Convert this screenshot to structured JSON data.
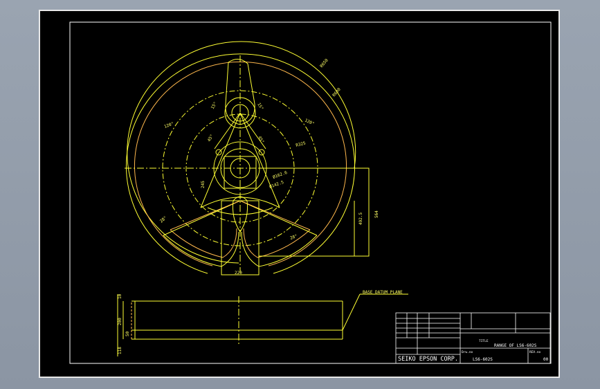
{
  "drawing": {
    "colors": {
      "background": "#000000",
      "frame": "#ffffff",
      "geometry_yellow": "#ffff33",
      "geometry_orange": "#ffb84d",
      "text": "#ffffff",
      "dimension": "#ffff66"
    },
    "dimensions": {
      "r650": "R650",
      "r600": "R600",
      "d325": "R325",
      "d162_6": "Ø162.6",
      "d142_5": "Ø142.5",
      "d245": "245",
      "d4925": "492.5",
      "d564": "564",
      "d220": "220",
      "a120_l": "120°",
      "a120_r": "120°",
      "a15_l": "15°",
      "a15_r": "15°",
      "a45_l": "45°",
      "a45_r": "45°",
      "a28_l": "28°",
      "a28_r": "28°"
    },
    "side_view": {
      "dim_10": "10",
      "dim_200": "200",
      "dim_50": "50",
      "dim_118": "118",
      "base_label": "BASE DATUM PLANE"
    },
    "title_block": {
      "title_small": "TITLE",
      "title": "RANGE OF LS6-602S",
      "drw_no_label": "Drw.no",
      "drw_no": "LS6-602S",
      "rev_label": "REV.no",
      "rev": "00",
      "company": "SEIKO EPSON CORP."
    }
  }
}
